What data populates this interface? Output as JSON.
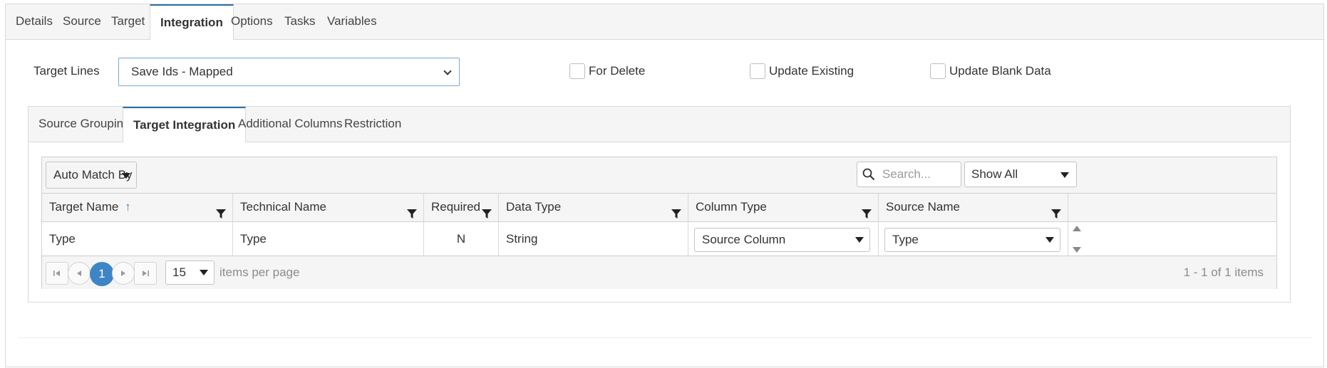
{
  "tabs": [
    {
      "label": "Details"
    },
    {
      "label": "Source"
    },
    {
      "label": "Target"
    },
    {
      "label": "Integration"
    },
    {
      "label": "Options"
    },
    {
      "label": "Tasks"
    },
    {
      "label": "Variables"
    }
  ],
  "form": {
    "target_lines_label": "Target Lines",
    "target_lines_value": "Save Ids - Mapped",
    "for_delete_label": "For Delete",
    "update_existing_label": "Update Existing",
    "update_blank_label": "Update Blank Data"
  },
  "inner_tabs": [
    {
      "label": "Source Grouping"
    },
    {
      "label": "Target Integration"
    },
    {
      "label": "Additional Columns"
    },
    {
      "label": "Restriction"
    }
  ],
  "toolbar": {
    "auto_match_label": "Auto Match By",
    "search_placeholder": "Search...",
    "show_filter_value": "Show All"
  },
  "grid": {
    "headers": [
      "Target Name",
      "Technical Name",
      "Required",
      "Data Type",
      "Column Type",
      "Source Name"
    ],
    "sort_indicator": "↑",
    "rows": [
      {
        "target_name": "Type",
        "technical_name": "Type",
        "required": "N",
        "data_type": "String",
        "column_type": "Source Column",
        "source_name": "Type"
      }
    ]
  },
  "pager": {
    "current_page": "1",
    "page_size": "15",
    "items_per_page_label": "items per page",
    "summary": "1 - 1 of 1 items"
  },
  "colors": {
    "accent": "#3d85c6",
    "tab_active_border": "#2e6da4"
  }
}
